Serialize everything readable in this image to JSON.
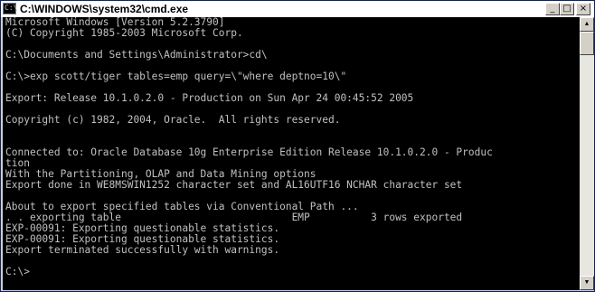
{
  "window": {
    "title": "C:\\WINDOWS\\system32\\cmd.exe",
    "icon": "cmd-icon",
    "controls": {
      "minimize": "_",
      "maximize": "□",
      "close": "×"
    }
  },
  "console": {
    "lines": [
      "Microsoft Windows [Version 5.2.3790]",
      "(C) Copyright 1985-2003 Microsoft Corp.",
      "",
      "C:\\Documents and Settings\\Administrator>cd\\",
      "",
      "C:\\>exp scott/tiger tables=emp query=\\\"where deptno=10\\\"",
      "",
      "Export: Release 10.1.0.2.0 - Production on Sun Apr 24 00:45:52 2005",
      "",
      "Copyright (c) 1982, 2004, Oracle.  All rights reserved.",
      "",
      "",
      "Connected to: Oracle Database 10g Enterprise Edition Release 10.1.0.2.0 - Produc",
      "tion",
      "With the Partitioning, OLAP and Data Mining options",
      "Export done in WE8MSWIN1252 character set and AL16UTF16 NCHAR character set",
      "",
      "About to export specified tables via Conventional Path ...",
      ". . exporting table                            EMP          3 rows exported",
      "EXP-00091: Exporting questionable statistics.",
      "EXP-00091: Exporting questionable statistics.",
      "Export terminated successfully with warnings.",
      "",
      "C:\\>"
    ]
  },
  "colors": {
    "console_bg": "#000000",
    "console_fg": "#c0c0c0",
    "chrome": "#d4d0c8"
  }
}
